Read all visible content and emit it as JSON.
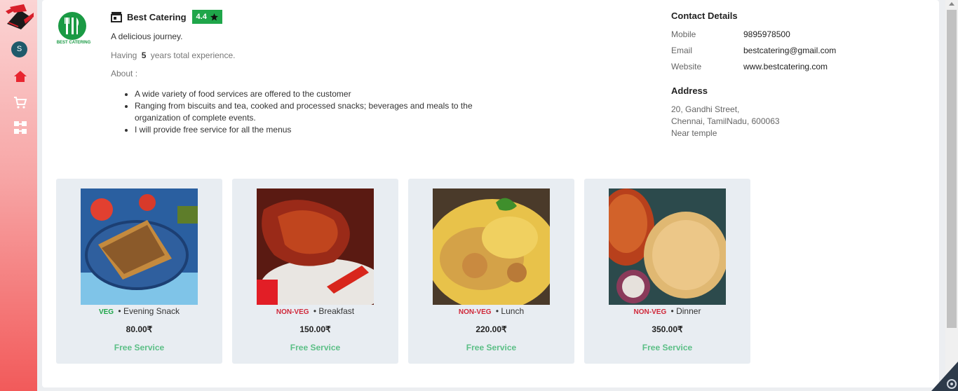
{
  "sidebar": {
    "avatar_initial": "S",
    "items": [
      {
        "name": "home-icon"
      },
      {
        "name": "cart-icon"
      },
      {
        "name": "dashboard-icon"
      }
    ]
  },
  "vendor": {
    "logo_caption": "BEST CATERING",
    "name": "Best Catering",
    "rating": "4.4",
    "tagline": "A delicious journey.",
    "experience_prefix": "Having",
    "experience_years": "5",
    "experience_suffix": "years total experience.",
    "about_label": "About :",
    "about_items": [
      "A wide variety of food services are offered to the customer",
      "Ranging from biscuits and tea, cooked and processed snacks; beverages and meals to the organization of complete events.",
      "I will provide free service for all the menus"
    ]
  },
  "contact": {
    "heading": "Contact Details",
    "mobile_label": "Mobile",
    "mobile": "9895978500",
    "email_label": "Email",
    "email": "bestcatering@gmail.com",
    "website_label": "Website",
    "website": "www.bestcatering.com"
  },
  "address": {
    "heading": "Address",
    "line1": "20, Gandhi Street,",
    "line2": "Chennai, TamilNadu, 600063",
    "line3": "Near temple"
  },
  "menus": [
    {
      "tag": "VEG",
      "category": "Evening Snack",
      "price": "80.00₹",
      "service": "Free Service",
      "image": "sandwich-image"
    },
    {
      "tag": "NON-VEG",
      "category": "Breakfast",
      "price": "150.00₹",
      "service": "Free Service",
      "image": "chicken-image"
    },
    {
      "tag": "NON-VEG",
      "category": "Lunch",
      "price": "220.00₹",
      "service": "Free Service",
      "image": "biryani-image"
    },
    {
      "tag": "NON-VEG",
      "category": "Dinner",
      "price": "350.00₹",
      "service": "Free Service",
      "image": "paratha-image"
    }
  ],
  "colors": {
    "accent_green": "#1fa64a",
    "nonveg_red": "#d0283a",
    "free_service": "#5bbf86",
    "sidebar_bottom": "#f25a5a"
  }
}
